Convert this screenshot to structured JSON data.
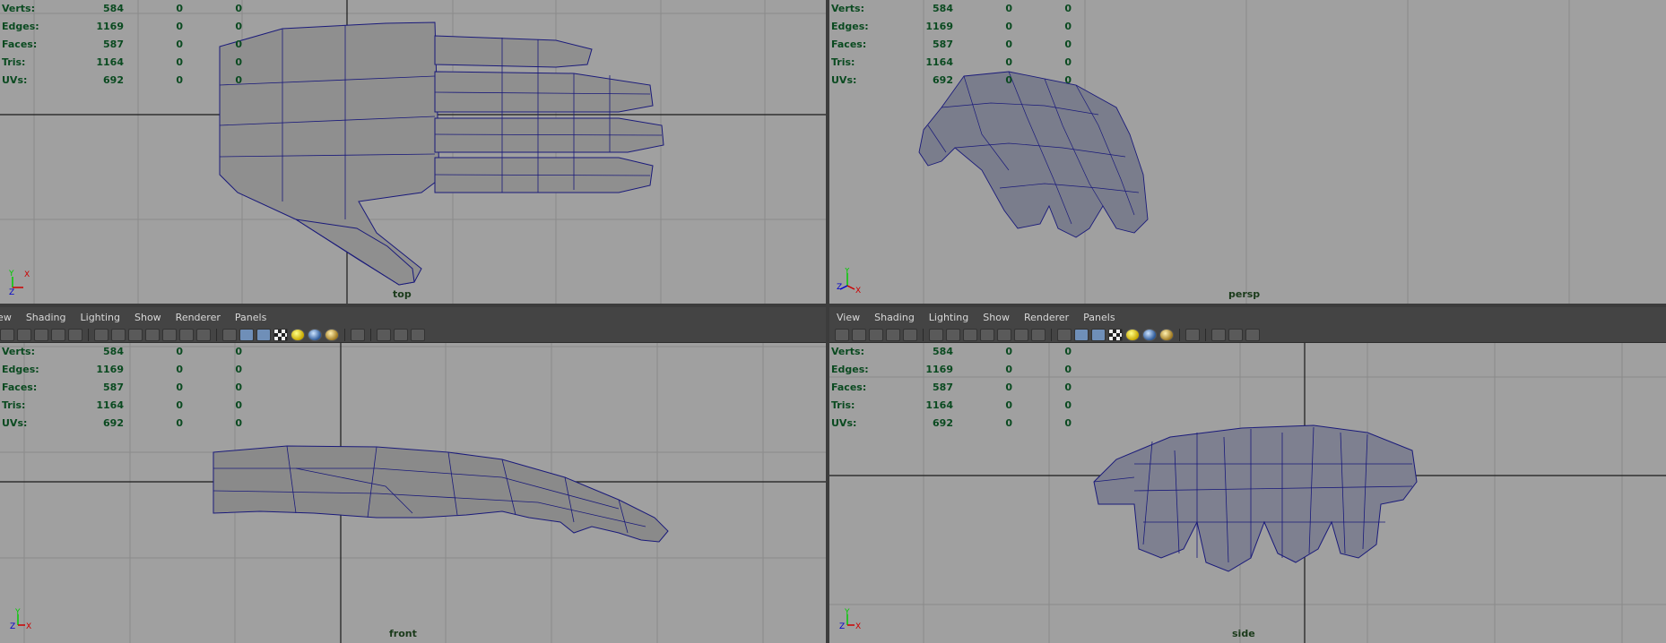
{
  "stats": {
    "rows": [
      {
        "label": "Verts:",
        "value": "584",
        "sel": "0",
        "sel2": "0"
      },
      {
        "label": "Edges:",
        "value": "1169",
        "sel": "0",
        "sel2": "0"
      },
      {
        "label": "Faces:",
        "value": "587",
        "sel": "0",
        "sel2": "0"
      },
      {
        "label": "Tris:",
        "value": "1164",
        "sel": "0",
        "sel2": "0"
      },
      {
        "label": "UVs:",
        "value": "692",
        "sel": "0",
        "sel2": "0"
      }
    ]
  },
  "viewports": {
    "top": {
      "camera": "top"
    },
    "persp": {
      "camera": "persp"
    },
    "front": {
      "camera": "front"
    },
    "side": {
      "camera": "side"
    }
  },
  "axes": {
    "top": {
      "a": "Y",
      "b": "X",
      "c": "Z"
    },
    "persp": {
      "a": "Y",
      "b": "Z",
      "c": "X"
    },
    "front": {
      "a": "Y",
      "b": "Z",
      "c": "X"
    },
    "side": {
      "a": "Y",
      "b": "Z",
      "c": "X"
    }
  },
  "panel_menu": {
    "left": [
      "iew",
      "Shading",
      "Lighting",
      "Show",
      "Renderer",
      "Panels"
    ],
    "right": [
      "View",
      "Shading",
      "Lighting",
      "Show",
      "Renderer",
      "Panels"
    ]
  },
  "colors": {
    "viewport_bg": "#a0a0a0",
    "grid_line": "#8a8a8a",
    "axis_line": "#1a1a1a",
    "wire": "#1a1a7a",
    "mesh_fill": "#8c8c8c",
    "hud_text": "#0a4a20"
  }
}
